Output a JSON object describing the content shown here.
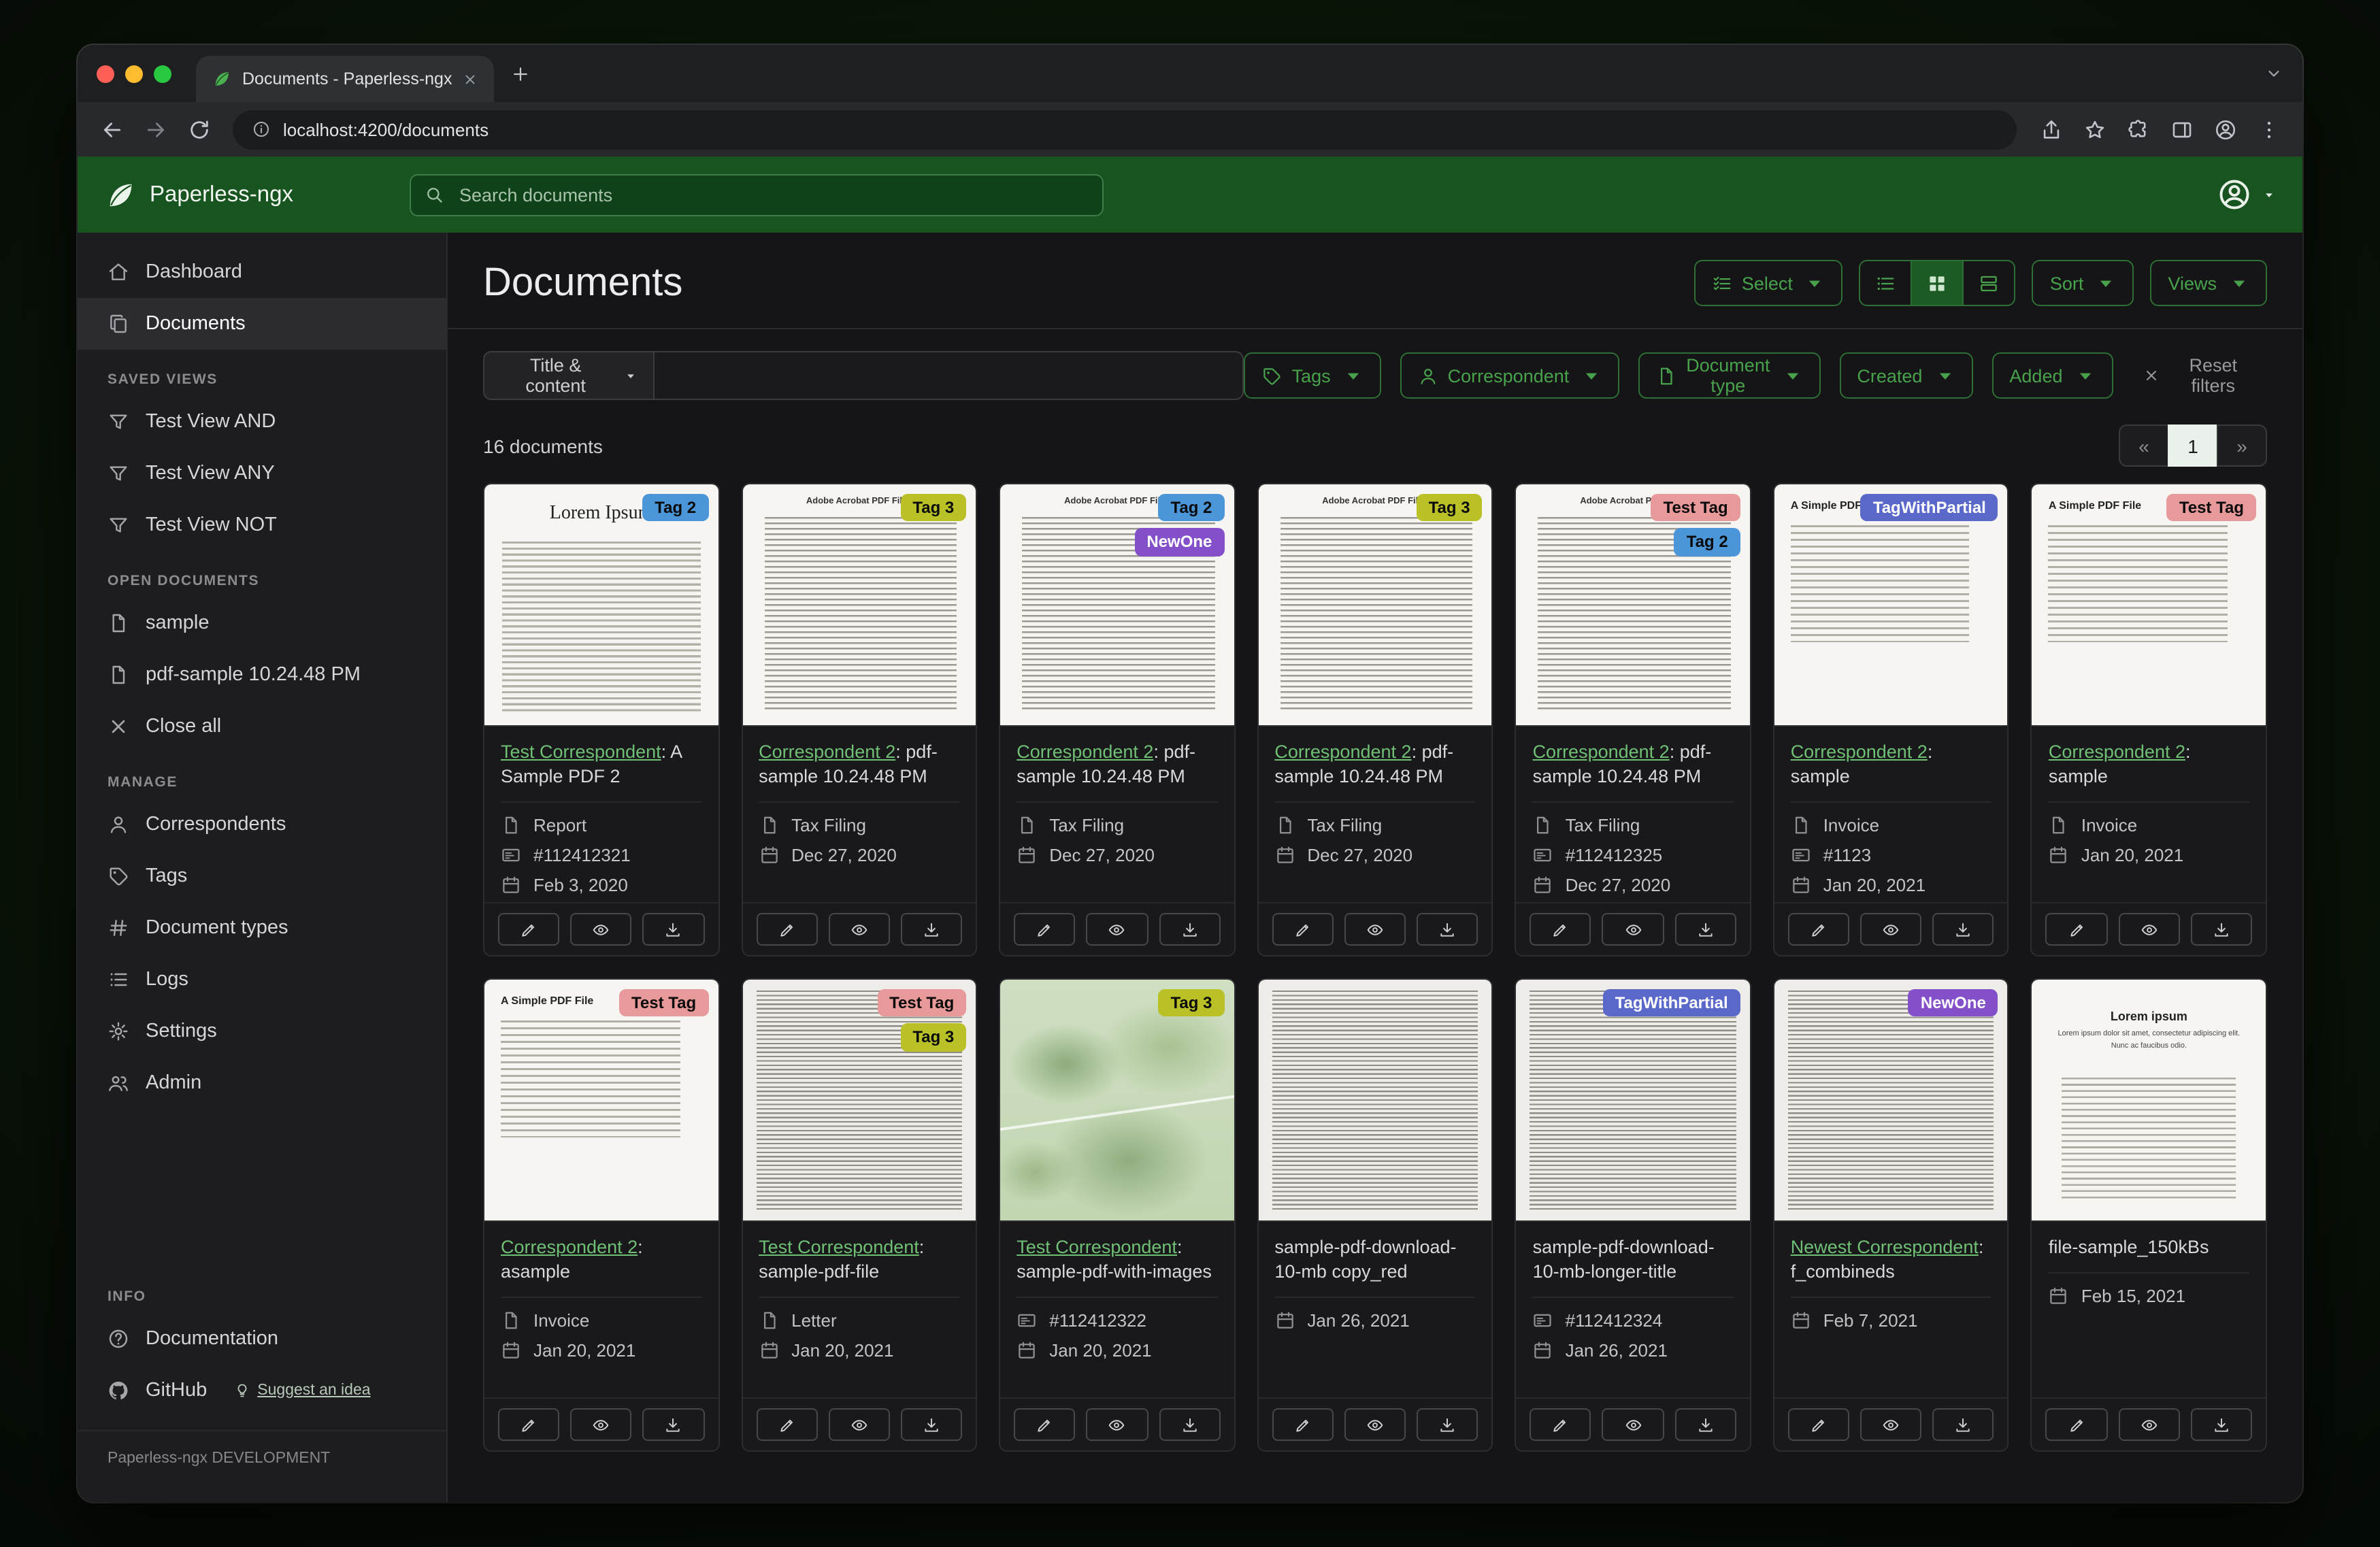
{
  "browser": {
    "tab_title": "Documents - Paperless-ngx",
    "url": "localhost:4200/documents"
  },
  "navbar": {
    "brand": "Paperless-ngx",
    "search_placeholder": "Search documents"
  },
  "sidebar": {
    "primary": [
      {
        "label": "Dashboard",
        "icon": "home",
        "slug": "dashboard",
        "active": false
      },
      {
        "label": "Documents",
        "icon": "docs",
        "slug": "documents",
        "active": true
      }
    ],
    "sections": [
      {
        "label": "SAVED VIEWS",
        "slug": "saved-views",
        "items": [
          {
            "label": "Test View AND",
            "icon": "funnel",
            "slug": "test-view-and"
          },
          {
            "label": "Test View ANY",
            "icon": "funnel",
            "slug": "test-view-any"
          },
          {
            "label": "Test View NOT",
            "icon": "funnel",
            "slug": "test-view-not"
          }
        ]
      },
      {
        "label": "OPEN DOCUMENTS",
        "slug": "open-documents",
        "items": [
          {
            "label": "sample",
            "icon": "file",
            "slug": "open-doc-sample"
          },
          {
            "label": "pdf-sample 10.24.48 PM",
            "icon": "file",
            "slug": "open-doc-pdf-sample"
          },
          {
            "label": "Close all",
            "icon": "x",
            "slug": "close-all"
          }
        ]
      },
      {
        "label": "MANAGE",
        "slug": "manage",
        "items": [
          {
            "label": "Correspondents",
            "icon": "person",
            "slug": "correspondents"
          },
          {
            "label": "Tags",
            "icon": "tag",
            "slug": "tags"
          },
          {
            "label": "Document types",
            "icon": "hash",
            "slug": "document-types"
          },
          {
            "label": "Logs",
            "icon": "listlines",
            "slug": "logs"
          },
          {
            "label": "Settings",
            "icon": "gear",
            "slug": "settings"
          },
          {
            "label": "Admin",
            "icon": "people",
            "slug": "admin"
          }
        ]
      },
      {
        "label": "INFO",
        "slug": "info",
        "items": [
          {
            "label": "Documentation",
            "icon": "question",
            "slug": "documentation"
          },
          {
            "label": "GitHub",
            "icon": "github",
            "slug": "github",
            "extra": "Suggest an idea"
          }
        ]
      }
    ],
    "footer": "Paperless-ngx DEVELOPMENT"
  },
  "main": {
    "title": "Documents",
    "select_label": "Select",
    "sort_label": "Sort",
    "views_label": "Views",
    "filter_dropdown": "Title & content",
    "filter_buttons": [
      {
        "label": "Tags",
        "icon": "tag",
        "slug": "tags"
      },
      {
        "label": "Correspondent",
        "icon": "person",
        "slug": "correspondent"
      },
      {
        "label": "Document type",
        "icon": "file",
        "slug": "document-type"
      },
      {
        "label": "Created",
        "icon": "",
        "slug": "created"
      },
      {
        "label": "Added",
        "icon": "",
        "slug": "added"
      }
    ],
    "reset_filters": "Reset filters",
    "count_text": "16 documents",
    "pagination": {
      "prev": "«",
      "page": "1",
      "next": "»"
    }
  },
  "tag_colors": {
    "Tag 2": {
      "bg": "#4a96d9",
      "fg": "#0b0b0b"
    },
    "Tag 3": {
      "bg": "#b9c127",
      "fg": "#0b0b0b"
    },
    "NewOne": {
      "bg": "#8450c9",
      "fg": "#ffffff"
    },
    "Test Tag": {
      "bg": "#e89a9b",
      "fg": "#0b0b0b"
    },
    "TagWithPartial": {
      "bg": "#5a68c9",
      "fg": "#ffffff"
    }
  },
  "cards": [
    {
      "thumb": "lorem",
      "thumb_title": "Lorem Ipsum",
      "tags": [
        "Tag 2"
      ],
      "correspondent": "Test Correspondent",
      "title": ": A Sample PDF 2",
      "meta": [
        {
          "icon": "file",
          "text": "Report"
        },
        {
          "icon": "card",
          "text": "#112412321"
        },
        {
          "icon": "cal",
          "text": "Feb 3, 2020"
        }
      ]
    },
    {
      "thumb": "acrobat",
      "thumb_title": "Adobe Acrobat PDF Files",
      "tags": [
        "Tag 3"
      ],
      "correspondent": "Correspondent 2",
      "title": ": pdf-sample 10.24.48 PM",
      "meta": [
        {
          "icon": "file",
          "text": "Tax Filing"
        },
        {
          "icon": "cal",
          "text": "Dec 27, 2020"
        }
      ]
    },
    {
      "thumb": "acrobat",
      "thumb_title": "Adobe Acrobat PDF Files",
      "tags": [
        "Tag 2",
        "NewOne"
      ],
      "correspondent": "Correspondent 2",
      "title": ": pdf-sample 10.24.48 PM",
      "meta": [
        {
          "icon": "file",
          "text": "Tax Filing"
        },
        {
          "icon": "cal",
          "text": "Dec 27, 2020"
        }
      ]
    },
    {
      "thumb": "acrobat",
      "thumb_title": "Adobe Acrobat PDF Files",
      "tags": [
        "Tag 3"
      ],
      "correspondent": "Correspondent 2",
      "title": ": pdf-sample 10.24.48 PM",
      "meta": [
        {
          "icon": "file",
          "text": "Tax Filing"
        },
        {
          "icon": "cal",
          "text": "Dec 27, 2020"
        }
      ]
    },
    {
      "thumb": "acrobat",
      "thumb_title": "Adobe Acrobat PDF Files",
      "tags": [
        "Test Tag",
        "Tag 2"
      ],
      "correspondent": "Correspondent 2",
      "title": ": pdf-sample 10.24.48 PM",
      "meta": [
        {
          "icon": "file",
          "text": "Tax Filing"
        },
        {
          "icon": "card",
          "text": "#112412325"
        },
        {
          "icon": "cal",
          "text": "Dec 27, 2020"
        }
      ]
    },
    {
      "thumb": "simple",
      "thumb_title": "A Simple PDF File",
      "tags": [
        "TagWithPartial"
      ],
      "correspondent": "Correspondent 2",
      "title": ": sample",
      "meta": [
        {
          "icon": "file",
          "text": "Invoice"
        },
        {
          "icon": "card",
          "text": "#1123"
        },
        {
          "icon": "cal",
          "text": "Jan 20, 2021"
        }
      ]
    },
    {
      "thumb": "simple",
      "thumb_title": "A Simple PDF File",
      "tags": [
        "Test Tag"
      ],
      "correspondent": "Correspondent 2",
      "title": ": sample",
      "meta": [
        {
          "icon": "file",
          "text": "Invoice"
        },
        {
          "icon": "cal",
          "text": "Jan 20, 2021"
        }
      ]
    },
    {
      "thumb": "simple",
      "thumb_title": "A Simple PDF File",
      "tags": [
        "Test Tag"
      ],
      "correspondent": "Correspondent 2",
      "title": ": asample",
      "meta": [
        {
          "icon": "file",
          "text": "Invoice"
        },
        {
          "icon": "cal",
          "text": "Jan 20, 2021"
        }
      ]
    },
    {
      "thumb": "dense",
      "thumb_title": "",
      "tags": [
        "Test Tag",
        "Tag 3"
      ],
      "correspondent": "Test Correspondent",
      "title": ": sample-pdf-file",
      "meta": [
        {
          "icon": "file",
          "text": "Letter"
        },
        {
          "icon": "cal",
          "text": "Jan 20, 2021"
        }
      ]
    },
    {
      "thumb": "map",
      "thumb_title": "",
      "tags": [
        "Tag 3"
      ],
      "correspondent": "Test Correspondent",
      "title": ": sample-pdf-with-images",
      "meta": [
        {
          "icon": "card",
          "text": "#112412322"
        },
        {
          "icon": "cal",
          "text": "Jan 20, 2021"
        }
      ]
    },
    {
      "thumb": "dense",
      "thumb_title": "",
      "tags": [],
      "correspondent": "",
      "title": "sample-pdf-download-10-mb copy_red",
      "meta": [
        {
          "icon": "cal",
          "text": "Jan 26, 2021"
        }
      ]
    },
    {
      "thumb": "dense",
      "thumb_title": "",
      "tags": [
        "TagWithPartial"
      ],
      "correspondent": "",
      "title": "sample-pdf-download-10-mb-longer-title",
      "meta": [
        {
          "icon": "card",
          "text": "#112412324"
        },
        {
          "icon": "cal",
          "text": "Jan 26, 2021"
        }
      ]
    },
    {
      "thumb": "dense",
      "thumb_title": "",
      "tags": [
        "NewOne"
      ],
      "correspondent": "Newest Correspondent",
      "title": ": f_combineds",
      "meta": [
        {
          "icon": "cal",
          "text": "Feb 7, 2021"
        }
      ]
    },
    {
      "thumb": "lorem-center",
      "thumb_title": "Lorem ipsum",
      "thumb_sub": "Lorem ipsum dolor sit amet, consectetur adipiscing elit. Nunc ac faucibus odio.",
      "tags": [],
      "correspondent": "",
      "title": "file-sample_150kBs",
      "meta": [
        {
          "icon": "cal",
          "text": "Feb 15, 2021"
        }
      ]
    }
  ]
}
